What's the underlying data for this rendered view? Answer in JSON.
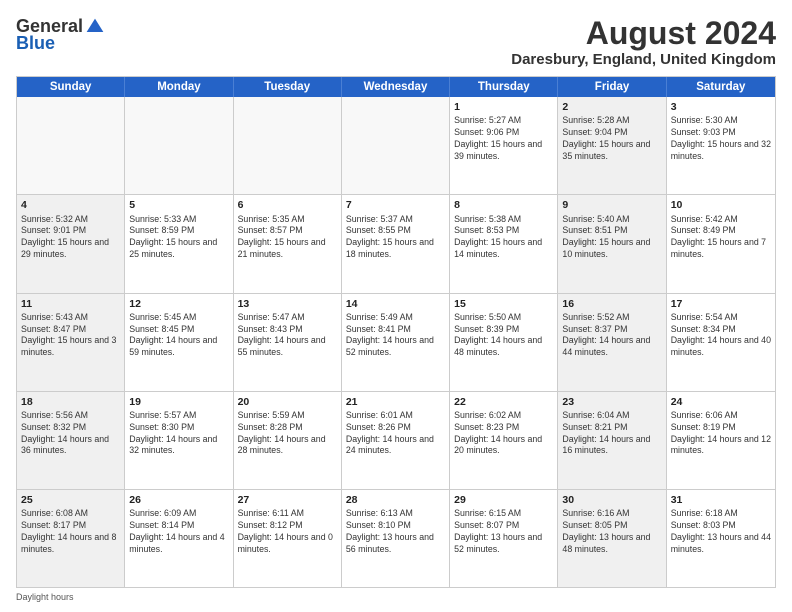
{
  "logo": {
    "general": "General",
    "blue": "Blue"
  },
  "title": "August 2024",
  "location": "Daresbury, England, United Kingdom",
  "days_of_week": [
    "Sunday",
    "Monday",
    "Tuesday",
    "Wednesday",
    "Thursday",
    "Friday",
    "Saturday"
  ],
  "footer": "Daylight hours",
  "weeks": [
    [
      {
        "day": "",
        "sunrise": "",
        "sunset": "",
        "daylight": "",
        "empty": true
      },
      {
        "day": "",
        "sunrise": "",
        "sunset": "",
        "daylight": "",
        "empty": true
      },
      {
        "day": "",
        "sunrise": "",
        "sunset": "",
        "daylight": "",
        "empty": true
      },
      {
        "day": "",
        "sunrise": "",
        "sunset": "",
        "daylight": "",
        "empty": true
      },
      {
        "day": "1",
        "sunrise": "Sunrise: 5:27 AM",
        "sunset": "Sunset: 9:06 PM",
        "daylight": "Daylight: 15 hours and 39 minutes.",
        "empty": false
      },
      {
        "day": "2",
        "sunrise": "Sunrise: 5:28 AM",
        "sunset": "Sunset: 9:04 PM",
        "daylight": "Daylight: 15 hours and 35 minutes.",
        "empty": false
      },
      {
        "day": "3",
        "sunrise": "Sunrise: 5:30 AM",
        "sunset": "Sunset: 9:03 PM",
        "daylight": "Daylight: 15 hours and 32 minutes.",
        "empty": false
      }
    ],
    [
      {
        "day": "4",
        "sunrise": "Sunrise: 5:32 AM",
        "sunset": "Sunset: 9:01 PM",
        "daylight": "Daylight: 15 hours and 29 minutes.",
        "empty": false
      },
      {
        "day": "5",
        "sunrise": "Sunrise: 5:33 AM",
        "sunset": "Sunset: 8:59 PM",
        "daylight": "Daylight: 15 hours and 25 minutes.",
        "empty": false
      },
      {
        "day": "6",
        "sunrise": "Sunrise: 5:35 AM",
        "sunset": "Sunset: 8:57 PM",
        "daylight": "Daylight: 15 hours and 21 minutes.",
        "empty": false
      },
      {
        "day": "7",
        "sunrise": "Sunrise: 5:37 AM",
        "sunset": "Sunset: 8:55 PM",
        "daylight": "Daylight: 15 hours and 18 minutes.",
        "empty": false
      },
      {
        "day": "8",
        "sunrise": "Sunrise: 5:38 AM",
        "sunset": "Sunset: 8:53 PM",
        "daylight": "Daylight: 15 hours and 14 minutes.",
        "empty": false
      },
      {
        "day": "9",
        "sunrise": "Sunrise: 5:40 AM",
        "sunset": "Sunset: 8:51 PM",
        "daylight": "Daylight: 15 hours and 10 minutes.",
        "empty": false
      },
      {
        "day": "10",
        "sunrise": "Sunrise: 5:42 AM",
        "sunset": "Sunset: 8:49 PM",
        "daylight": "Daylight: 15 hours and 7 minutes.",
        "empty": false
      }
    ],
    [
      {
        "day": "11",
        "sunrise": "Sunrise: 5:43 AM",
        "sunset": "Sunset: 8:47 PM",
        "daylight": "Daylight: 15 hours and 3 minutes.",
        "empty": false
      },
      {
        "day": "12",
        "sunrise": "Sunrise: 5:45 AM",
        "sunset": "Sunset: 8:45 PM",
        "daylight": "Daylight: 14 hours and 59 minutes.",
        "empty": false
      },
      {
        "day": "13",
        "sunrise": "Sunrise: 5:47 AM",
        "sunset": "Sunset: 8:43 PM",
        "daylight": "Daylight: 14 hours and 55 minutes.",
        "empty": false
      },
      {
        "day": "14",
        "sunrise": "Sunrise: 5:49 AM",
        "sunset": "Sunset: 8:41 PM",
        "daylight": "Daylight: 14 hours and 52 minutes.",
        "empty": false
      },
      {
        "day": "15",
        "sunrise": "Sunrise: 5:50 AM",
        "sunset": "Sunset: 8:39 PM",
        "daylight": "Daylight: 14 hours and 48 minutes.",
        "empty": false
      },
      {
        "day": "16",
        "sunrise": "Sunrise: 5:52 AM",
        "sunset": "Sunset: 8:37 PM",
        "daylight": "Daylight: 14 hours and 44 minutes.",
        "empty": false
      },
      {
        "day": "17",
        "sunrise": "Sunrise: 5:54 AM",
        "sunset": "Sunset: 8:34 PM",
        "daylight": "Daylight: 14 hours and 40 minutes.",
        "empty": false
      }
    ],
    [
      {
        "day": "18",
        "sunrise": "Sunrise: 5:56 AM",
        "sunset": "Sunset: 8:32 PM",
        "daylight": "Daylight: 14 hours and 36 minutes.",
        "empty": false
      },
      {
        "day": "19",
        "sunrise": "Sunrise: 5:57 AM",
        "sunset": "Sunset: 8:30 PM",
        "daylight": "Daylight: 14 hours and 32 minutes.",
        "empty": false
      },
      {
        "day": "20",
        "sunrise": "Sunrise: 5:59 AM",
        "sunset": "Sunset: 8:28 PM",
        "daylight": "Daylight: 14 hours and 28 minutes.",
        "empty": false
      },
      {
        "day": "21",
        "sunrise": "Sunrise: 6:01 AM",
        "sunset": "Sunset: 8:26 PM",
        "daylight": "Daylight: 14 hours and 24 minutes.",
        "empty": false
      },
      {
        "day": "22",
        "sunrise": "Sunrise: 6:02 AM",
        "sunset": "Sunset: 8:23 PM",
        "daylight": "Daylight: 14 hours and 20 minutes.",
        "empty": false
      },
      {
        "day": "23",
        "sunrise": "Sunrise: 6:04 AM",
        "sunset": "Sunset: 8:21 PM",
        "daylight": "Daylight: 14 hours and 16 minutes.",
        "empty": false
      },
      {
        "day": "24",
        "sunrise": "Sunrise: 6:06 AM",
        "sunset": "Sunset: 8:19 PM",
        "daylight": "Daylight: 14 hours and 12 minutes.",
        "empty": false
      }
    ],
    [
      {
        "day": "25",
        "sunrise": "Sunrise: 6:08 AM",
        "sunset": "Sunset: 8:17 PM",
        "daylight": "Daylight: 14 hours and 8 minutes.",
        "empty": false
      },
      {
        "day": "26",
        "sunrise": "Sunrise: 6:09 AM",
        "sunset": "Sunset: 8:14 PM",
        "daylight": "Daylight: 14 hours and 4 minutes.",
        "empty": false
      },
      {
        "day": "27",
        "sunrise": "Sunrise: 6:11 AM",
        "sunset": "Sunset: 8:12 PM",
        "daylight": "Daylight: 14 hours and 0 minutes.",
        "empty": false
      },
      {
        "day": "28",
        "sunrise": "Sunrise: 6:13 AM",
        "sunset": "Sunset: 8:10 PM",
        "daylight": "Daylight: 13 hours and 56 minutes.",
        "empty": false
      },
      {
        "day": "29",
        "sunrise": "Sunrise: 6:15 AM",
        "sunset": "Sunset: 8:07 PM",
        "daylight": "Daylight: 13 hours and 52 minutes.",
        "empty": false
      },
      {
        "day": "30",
        "sunrise": "Sunrise: 6:16 AM",
        "sunset": "Sunset: 8:05 PM",
        "daylight": "Daylight: 13 hours and 48 minutes.",
        "empty": false
      },
      {
        "day": "31",
        "sunrise": "Sunrise: 6:18 AM",
        "sunset": "Sunset: 8:03 PM",
        "daylight": "Daylight: 13 hours and 44 minutes.",
        "empty": false
      }
    ]
  ]
}
